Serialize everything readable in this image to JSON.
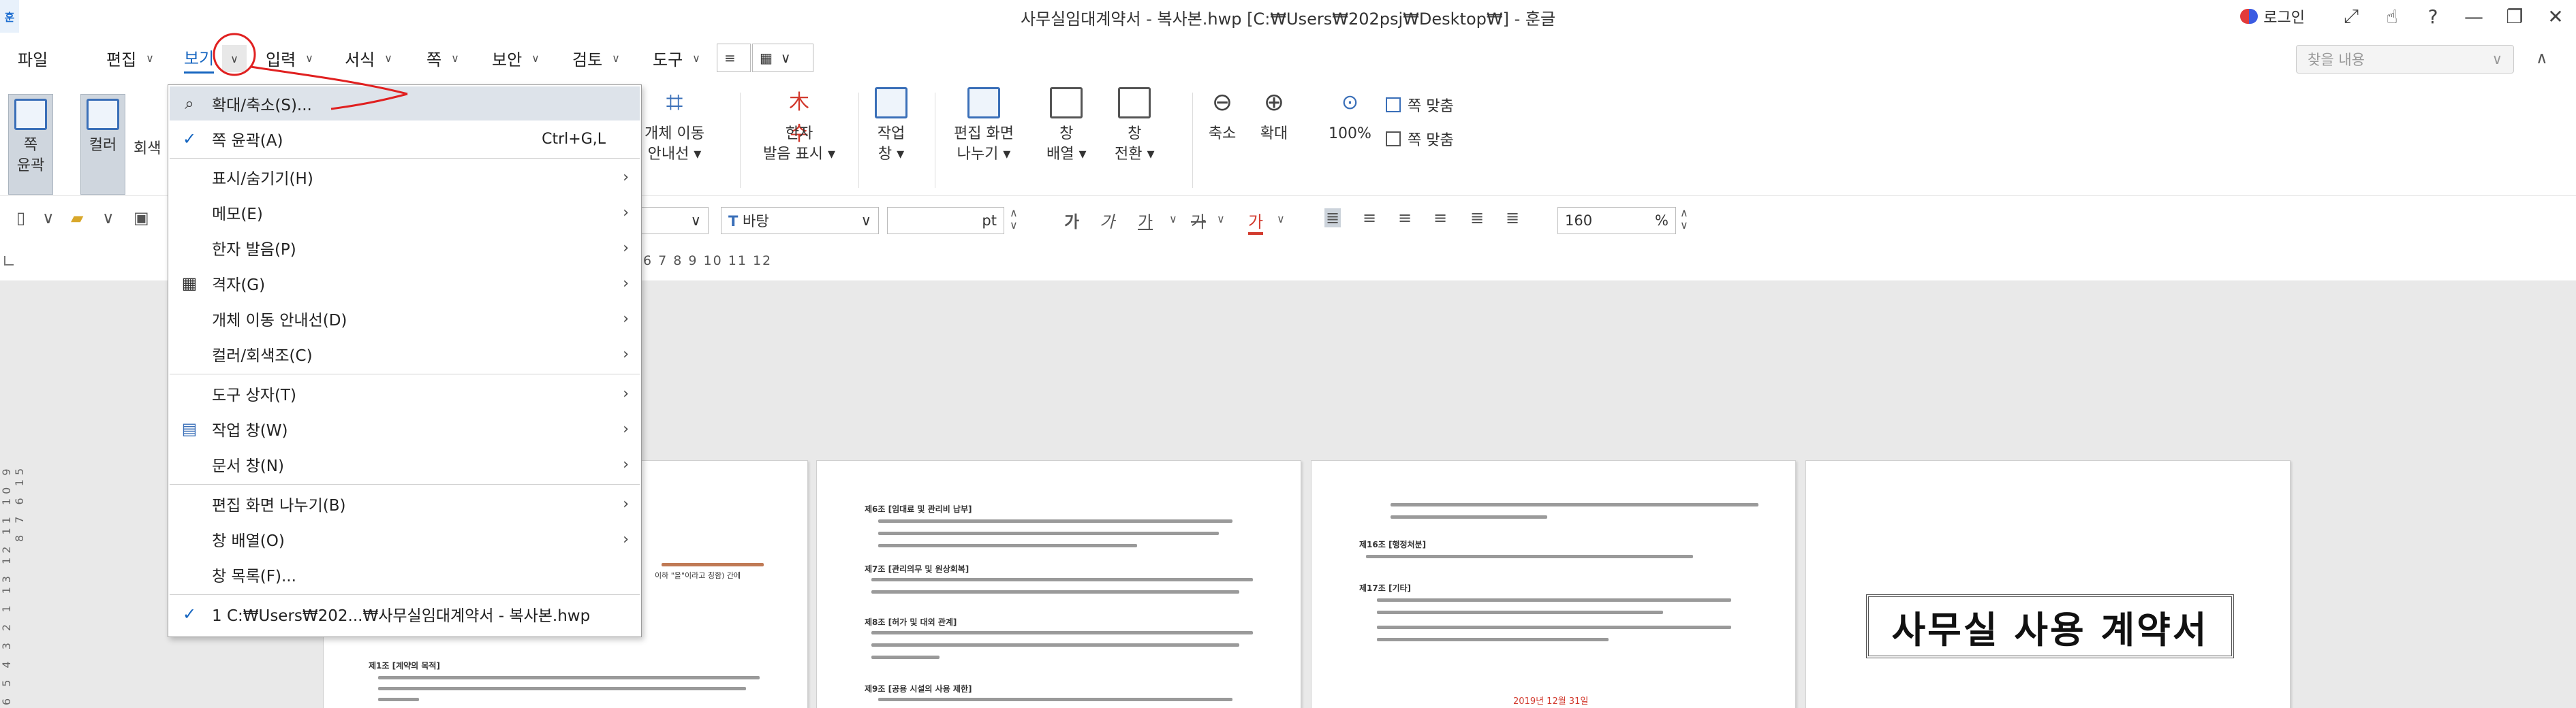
{
  "window": {
    "title": "사무실임대계약서 - 복사본.hwp [C:₩Users₩202psj₩Desktop₩] - 훈글",
    "logo": "훈",
    "login_label": "로그인",
    "controls": [
      "expand-icon",
      "touch-icon",
      "help-icon",
      "minimize-icon",
      "restore-icon",
      "close-icon"
    ]
  },
  "menubar": {
    "items": [
      {
        "label": "파일",
        "has_caret": false
      },
      {
        "label": "편집",
        "has_caret": true
      },
      {
        "label": "보기",
        "has_caret": true,
        "active": true
      },
      {
        "label": "입력",
        "has_caret": true
      },
      {
        "label": "서식",
        "has_caret": true
      },
      {
        "label": "쪽",
        "has_caret": true
      },
      {
        "label": "보안",
        "has_caret": true
      },
      {
        "label": "검토",
        "has_caret": true
      },
      {
        "label": "도구",
        "has_caret": true
      }
    ],
    "search_placeholder": "찾을 내용"
  },
  "ribbon": {
    "buttons": [
      {
        "label": "쪽\n윤곽"
      },
      {
        "label": "컬러"
      },
      {
        "label": "회색"
      },
      {
        "label": "개체 이동\n안내선 ▾"
      },
      {
        "label": "한자\n발음 표시 ▾"
      },
      {
        "label": "작업\n창 ▾"
      },
      {
        "label": "편집 화면\n나누기 ▾"
      },
      {
        "label": "창\n배열 ▾"
      },
      {
        "label": "창\n전환 ▾"
      },
      {
        "label": "축소"
      },
      {
        "label": "확대"
      },
      {
        "label": "100%"
      }
    ],
    "fit_width": "쪽 맞춤",
    "fit_page": "쪽 맞춤"
  },
  "formatbar": {
    "font_name": "바탕",
    "font_size_unit": "pt",
    "zoom_value": "160",
    "zoom_unit": "%",
    "style_glyphs": [
      "가",
      "가",
      "가",
      "가",
      "가"
    ]
  },
  "ruler": {
    "numbers": "6 7 8 9 10 11 12"
  },
  "vruler": {
    "numbers": "6 5 4 3 2 1 13 12 11 10 9 8 7 6 15"
  },
  "dropdown": {
    "items": [
      {
        "label": "확대/축소(S)...",
        "icon": "search-icon",
        "shortcut": "",
        "submenu": false
      },
      {
        "label": "쪽 윤곽(A)",
        "icon": "check-icon",
        "shortcut": "Ctrl+G,L",
        "submenu": false
      },
      {
        "label": "표시/숨기기(H)",
        "icon": "",
        "shortcut": "",
        "submenu": true
      },
      {
        "label": "메모(E)",
        "icon": "",
        "shortcut": "",
        "submenu": true
      },
      {
        "label": "한자 발음(P)",
        "icon": "",
        "shortcut": "",
        "submenu": true
      },
      {
        "label": "격자(G)",
        "icon": "grid-icon",
        "shortcut": "",
        "submenu": true
      },
      {
        "label": "개체 이동 안내선(D)",
        "icon": "",
        "shortcut": "",
        "submenu": true
      },
      {
        "label": "컬러/회색조(C)",
        "icon": "",
        "shortcut": "",
        "submenu": true
      },
      {
        "label": "도구 상자(T)",
        "icon": "",
        "shortcut": "",
        "submenu": true
      },
      {
        "label": "작업 창(W)",
        "icon": "task-pane-icon",
        "shortcut": "",
        "submenu": true
      },
      {
        "label": "문서 창(N)",
        "icon": "",
        "shortcut": "",
        "submenu": true
      },
      {
        "label": "편집 화면 나누기(B)",
        "icon": "",
        "shortcut": "",
        "submenu": true
      },
      {
        "label": "창 배열(O)",
        "icon": "",
        "shortcut": "",
        "submenu": true
      },
      {
        "label": "창 목록(F)...",
        "icon": "",
        "shortcut": "",
        "submenu": false
      },
      {
        "label": "1 C:₩Users₩202...₩사무실임대계약서 - 복사본.hwp",
        "icon": "check-icon",
        "shortcut": "",
        "submenu": false
      }
    ]
  },
  "pages": {
    "page1_texts": [
      "이하 \"을\"이라고 칭함) 간에",
      "제1조 [계약의 목적]"
    ],
    "page2_heads": [
      "제6조 [임대료 및 관리비 납부]",
      "제7조 [관리의무 및 원상회복]",
      "제8조 [허가 및 대외 관계]",
      "제9조 [공용 시설의 사용 제한]"
    ],
    "page3_heads": [
      "제16조 [행정처분]",
      "제17조 [기타]"
    ],
    "page3_date": "2019년 12월 31일",
    "page4_title": "사무실 사용 계약서"
  }
}
